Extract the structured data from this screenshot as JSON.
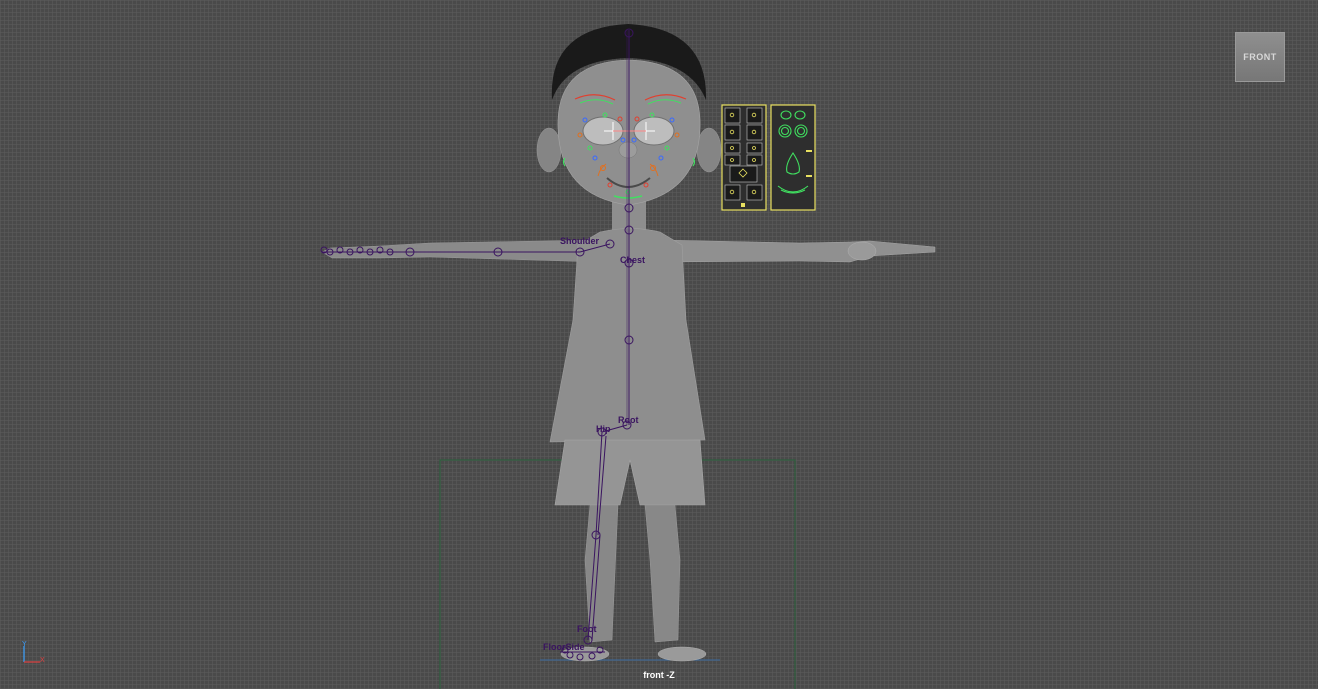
{
  "viewport": {
    "camera_label": "front -Z",
    "view_cube_label": "FRONT",
    "background_color": "#4a4a4a",
    "grid_color": "#5a5a5a"
  },
  "axis": {
    "y_label": "Y",
    "x_label": "X",
    "y_color": "#3aa0ff",
    "x_color": "#e04040"
  },
  "rig": {
    "joint_color": "#3a1460",
    "face_panel_color": "#e8e060",
    "face_curve_color": "#40e060",
    "labels": {
      "shoulder": "Shoulder",
      "chest": "Chest",
      "root": "Root",
      "hip": "Hip",
      "foot": "Foot",
      "floor_side": "FloorSide"
    }
  }
}
